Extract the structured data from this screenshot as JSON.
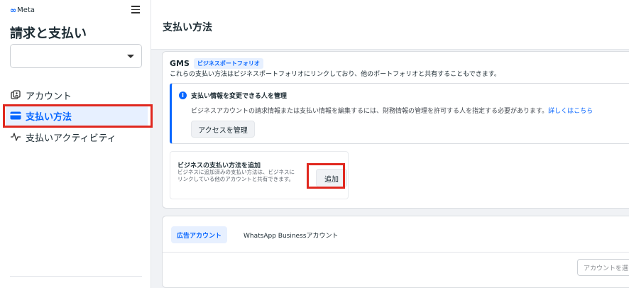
{
  "brand": {
    "name": "Meta"
  },
  "sidebar": {
    "title": "請求と支払い",
    "select_value": "",
    "items": [
      {
        "label": "アカウント",
        "icon": "accounts-icon",
        "active": false
      },
      {
        "label": "支払い方法",
        "icon": "credit-card-icon",
        "active": true
      },
      {
        "label": "支払いアクティビティ",
        "icon": "activity-pulse-icon",
        "active": false
      }
    ]
  },
  "header": {
    "title": "支払い方法"
  },
  "gms": {
    "name": "GMS",
    "badge": "ビジネスポートフォリオ",
    "description": "これらの支払い方法はビジネスポートフォリオにリンクしており、他のポートフォリオと共有することもできます。"
  },
  "info": {
    "title": "支払い情報を変更できる人を管理",
    "text": "ビジネスアカウントの請求情報または支払い情報を編集するには、財務情報の管理を許可する人を指定する必要があります。",
    "link": "詳しくはこちら",
    "button": "アクセスを管理"
  },
  "add_payment": {
    "title": "ビジネスの支払い方法を追加",
    "description": "ビジネスに追加済みの支払い方法は、ビジネスにリンクしている他のアカウントと共有できます。",
    "button": "追加"
  },
  "tabs": [
    {
      "label": "広告アカウント",
      "active": true
    },
    {
      "label": "WhatsApp Businessアカウント",
      "active": false
    }
  ],
  "account_search": {
    "placeholder": "アカウントを選"
  },
  "colors": {
    "accent": "#0866ff",
    "highlight": "#e0281f"
  }
}
